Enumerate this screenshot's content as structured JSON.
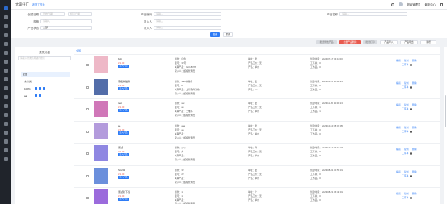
{
  "app": {
    "brand": "大家好厂",
    "switch_label": "返回工作台",
    "user_name": "超级管理员",
    "user_menu": "最新中心"
  },
  "sidebar": {
    "icons": [
      "home-icon",
      "grid-icon",
      "list-icon",
      "chart-icon",
      "box-icon",
      "cart-icon",
      "user-icon",
      "tag-icon",
      "truck-icon",
      "money-icon",
      "doc-icon",
      "star-icon",
      "gear-icon",
      "message-icon",
      "bell-icon",
      "folder-icon",
      "help-icon",
      "setting-icon"
    ]
  },
  "filters": {
    "created_label": "创建日期",
    "created_start": "开始日期",
    "created_end": "结束日期",
    "product_code_label": "产品编码",
    "product_code_ph": "请输入",
    "product_name_label": "产品名称",
    "product_name_ph": "请输入",
    "spec_label": "规格",
    "spec_ph": "请输入",
    "entry_label": "录入人",
    "entry_ph": "请输入",
    "status_label": "产品状态",
    "status_value": "全部",
    "creator_label": "录入人",
    "creator_ph": "请输入",
    "search_btn": "搜索",
    "reset_btn": "重置"
  },
  "toolbar": {
    "b1": "批量修改产品",
    "b2": "批量产品删除",
    "b3": "批量打印",
    "b4": "产品导入",
    "b5": "产品导出",
    "b6": "新增"
  },
  "category": {
    "title": "类别分组",
    "search_ph": "请输入分类名称进行搜索",
    "all": "全部",
    "n1": "未分类",
    "n2": "100%",
    "n3": "aa"
  },
  "list": {
    "all_tab": "全部",
    "rows": [
      {
        "name": "bab",
        "price": "¥ 1.00",
        "tag": "加入产品",
        "c2a": "颜色：红色",
        "c2b": "型号：32号",
        "c2c": "关联产品：GC18678",
        "c2d": "录入人：超级管理员",
        "c3a": "单位：套",
        "c3b": "产品工价：无",
        "c3c": "产品：单价",
        "c4a": "创建时间：2024-07-17 14:11:00",
        "c4b": "工序总：0",
        "c4c": "工作品：0"
      },
      {
        "name": "东极种猫科",
        "price": "¥ 2.00",
        "tag": "加入产品",
        "c2a": "颜色：Siku城藤色",
        "c2b": "型号：8",
        "c2c": "关联产品：上海取件对象",
        "c2d": "录入人：超级管理员",
        "c3a": "单位：套",
        "c3b": "产品工价：无",
        "c3c": "产品：aa",
        "c4a": "创建时间：2023-11-25 15:02:34",
        "c4b": "工序总：0",
        "c4c": "工作品：0"
      },
      {
        "name": "test",
        "price": "¥ 1.00",
        "tag": "加入产品",
        "c2a": "颜色：ww",
        "c2b": "型号：ab",
        "c2c": "关联产品：二维码",
        "c2d": "录入人：超级管理员",
        "c3a": "单位：套",
        "c3b": "产品工价：无",
        "c3c": "产品：单价",
        "c4a": "创建时间：2023-11-20 14:00:13",
        "c4b": "工序总：1",
        "c4c": "工作品：1"
      },
      {
        "name": "aa",
        "price": "¥ 1.00",
        "tag": "加入产品",
        "c2a": "颜色：aaa",
        "c2b": "型号：aa",
        "c2c": "关联产品：",
        "c2d": "录入人：超级管理员",
        "c3a": "单位：套",
        "c3b": "产品工价：无",
        "c3c": "产品：单价",
        "c4a": "创建时间：2023-10-10 18:03:05",
        "c4b": "工序总：0",
        "c4c": "工作品：0"
      },
      {
        "name": "测试",
        "price": "¥ 1.00",
        "tag": "加入产品",
        "c2a": "颜色：gray",
        "c2b": "型号：大",
        "c2c": "关联产品：",
        "c2d": "录入人：超级管理员",
        "c3a": "单位：件",
        "c3b": "产品工价：无",
        "c3c": "产品：单价",
        "c4a": "创建时间：2023-10-12 17:10:27",
        "c4b": "工序总：0",
        "c4c": "工作品：0"
      },
      {
        "name": "SC202",
        "price": "¥ 1.00",
        "tag": "加入产品",
        "c2a": "颜色：32",
        "c2b": "型号：22",
        "c2c": "关联产品：",
        "c2d": "录入人：超级管理员",
        "c3a": "单位：套",
        "c3b": "产品工价：无",
        "c3c": "产品：单价",
        "c4a": "创建时间：2023-08-31 10:59:31",
        "c4b": "工序总：0",
        "c4c": "工作品：0"
      },
      {
        "name": "测试新下载",
        "price": "¥ 1.00",
        "tag": "加入产品",
        "c2a": "颜色：1",
        "c2b": "型号：1",
        "c2c": "关联产品：",
        "c2d": "录入人：超级管理员",
        "c3a": "单位：个",
        "c3b": "产品工价：无",
        "c3c": "产品：单价",
        "c4a": "创建时间：2023-08-21 15:40:01",
        "c4b": "工序总：0",
        "c4c": "工作品：0"
      }
    ],
    "op_edit": "编辑",
    "op_copy": "复制",
    "op_delete": "删除",
    "op_process": "工序单"
  },
  "colors": {
    "accent": "#2e7cf6",
    "danger": "#e85a4f",
    "sidebar": "#20242b"
  }
}
